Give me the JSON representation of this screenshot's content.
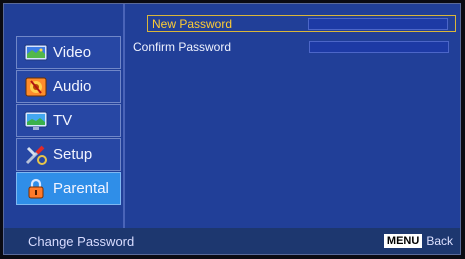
{
  "sidebar": {
    "items": [
      {
        "label": "Video",
        "icon": "video-icon",
        "active": false
      },
      {
        "label": "Audio",
        "icon": "audio-icon",
        "active": false
      },
      {
        "label": "TV",
        "icon": "tv-icon",
        "active": false
      },
      {
        "label": "Setup",
        "icon": "setup-icon",
        "active": false
      },
      {
        "label": "Parental",
        "icon": "parental-lock-icon",
        "active": true
      }
    ]
  },
  "content": {
    "rows": [
      {
        "label": "New Password",
        "value": "",
        "selected": true
      },
      {
        "label": "Confirm Password",
        "value": "",
        "selected": false
      }
    ]
  },
  "status_bar": {
    "title": "Change Password",
    "menu_key": "MENU",
    "back_label": "Back"
  },
  "colors": {
    "background": "#213f98",
    "selected_item": "#2f8ee8",
    "highlight_text": "#ffcd33",
    "status_bar": "#1d376f"
  }
}
